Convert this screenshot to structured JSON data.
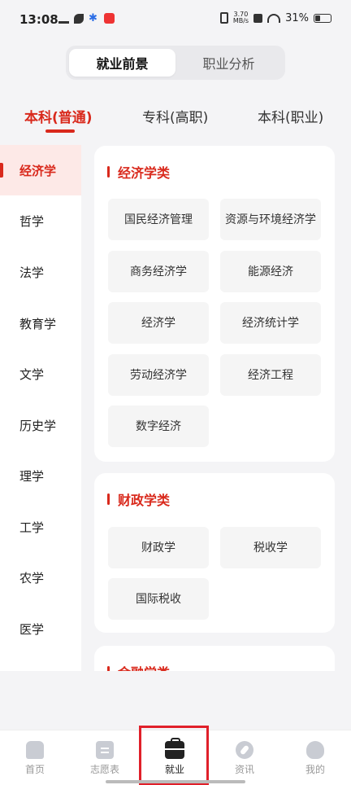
{
  "status_bar": {
    "time": "13:08",
    "net_speed_value": "3.70",
    "net_speed_unit": "MB/s",
    "battery": "31%",
    "left_icons": [
      "crown-icon",
      "leaf-icon",
      "paw-icon",
      "app-icon"
    ],
    "right_icons": [
      "vibrate-icon",
      "x-icon",
      "wifi-icon",
      "battery-icon"
    ]
  },
  "segment": {
    "items": [
      "就业前景",
      "职业分析"
    ],
    "selected": 0
  },
  "tabs": {
    "items": [
      "本科(普通)",
      "专科(高职)",
      "本科(职业)"
    ],
    "selected": 0
  },
  "sidebar": {
    "items": [
      "经济学",
      "哲学",
      "法学",
      "教育学",
      "文学",
      "历史学",
      "理学",
      "工学",
      "农学",
      "医学"
    ],
    "selected": 0
  },
  "categories": [
    {
      "title": "经济学类",
      "majors": [
        "国民经济管理",
        "资源与环境经济学",
        "商务经济学",
        "能源经济",
        "经济学",
        "经济统计学",
        "劳动经济学",
        "经济工程",
        "数字经济"
      ]
    },
    {
      "title": "财政学类",
      "majors": [
        "财政学",
        "税收学",
        "国际税收"
      ]
    },
    {
      "title": "金融学类",
      "majors": []
    }
  ],
  "bottom_nav": {
    "items": [
      {
        "label": "首页",
        "icon": "home-icon"
      },
      {
        "label": "志愿表",
        "icon": "document-icon"
      },
      {
        "label": "就业",
        "icon": "briefcase-icon"
      },
      {
        "label": "资讯",
        "icon": "compass-icon"
      },
      {
        "label": "我的",
        "icon": "profile-icon"
      }
    ],
    "selected": 2
  },
  "colors": {
    "accent": "#d9291c",
    "highlight_box": "#e0202a"
  }
}
